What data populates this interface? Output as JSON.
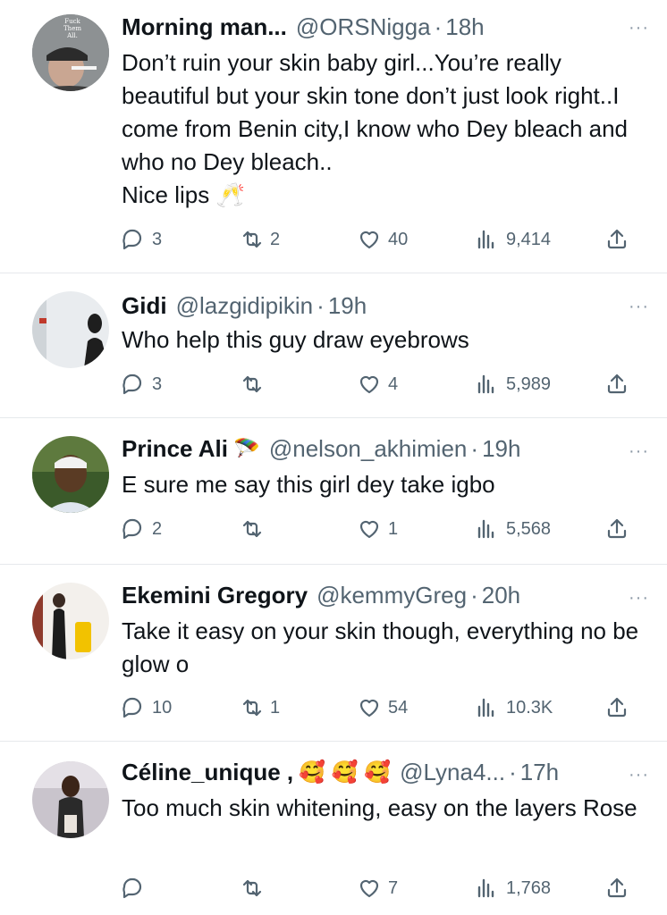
{
  "tweets": [
    {
      "name": "Morning man...",
      "handle": "@ORSNigga",
      "time": "18h",
      "text": "Don’t ruin your skin baby girl...You’re really beautiful but your skin tone don’t just look right..I come from Benin city,I know who Dey bleach and who no Dey bleach..\nNice lips 🥂",
      "replies": "3",
      "retweets": "2",
      "likes": "40",
      "views": "9,414",
      "avatar_text": "Fuck\nThem\nAll."
    },
    {
      "name": "Gidi",
      "handle": "@lazgidipikin",
      "time": "19h",
      "text": "Who help this guy draw eyebrows",
      "replies": "3",
      "retweets": "",
      "likes": "4",
      "views": "5,989"
    },
    {
      "name": "Prince Ali",
      "name_emoji": "🪂",
      "handle": "@nelson_akhimien",
      "time": "19h",
      "text": "E sure me say  this girl dey take igbo",
      "replies": "2",
      "retweets": "",
      "likes": "1",
      "views": "5,568"
    },
    {
      "name": "Ekemini Gregory",
      "handle": "@kemmyGreg",
      "time": "20h",
      "text": "Take it easy on your skin though, everything no be glow o",
      "replies": "10",
      "retweets": "1",
      "likes": "54",
      "views": "10.3K"
    },
    {
      "name": "Céline_unique ,",
      "name_emoji": "🥰 🥰 🥰",
      "handle": "@Lyna4...",
      "time": "17h",
      "text": "Too much skin whitening, easy on the layers Rose",
      "replies": "",
      "retweets": "",
      "likes": "7",
      "views": "1,768"
    }
  ],
  "ui": {
    "more_glyph": "···",
    "separator": "·"
  },
  "colors": {
    "text": "#0f1419",
    "muted": "#536471",
    "divider": "#e6e9ec"
  }
}
